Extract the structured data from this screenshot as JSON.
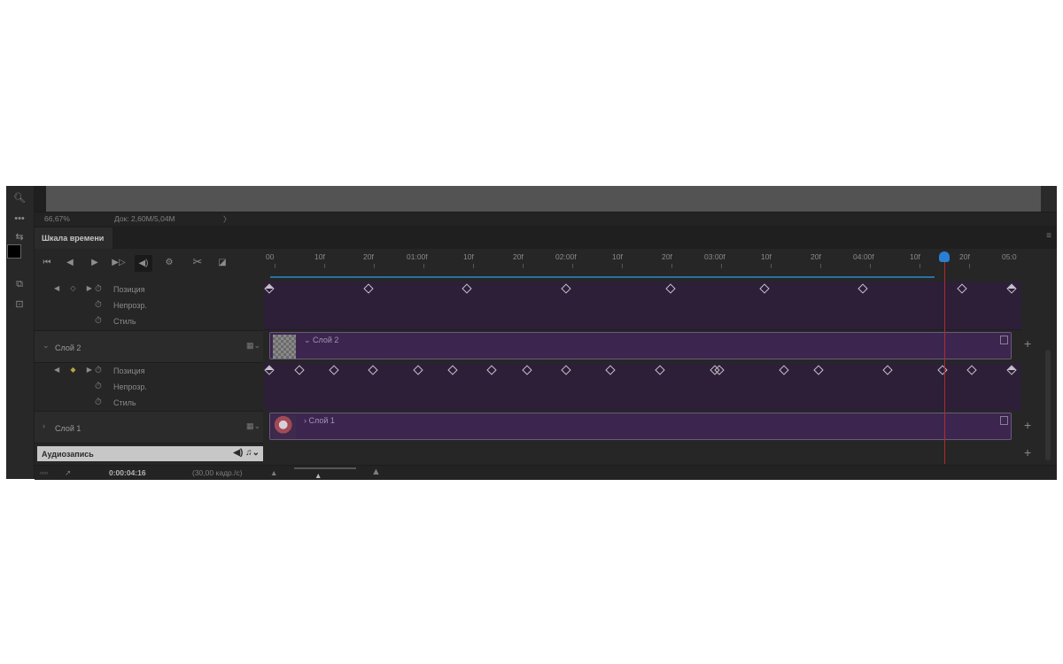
{
  "status_bar": {
    "zoom": "66,67%",
    "doc": "Док: 2,60M/5,04M",
    "arrow": "〉"
  },
  "panel": {
    "tab": "Шкала времени",
    "menu_icon": "≡"
  },
  "controls": [
    "⏮",
    "◀",
    "▶",
    "▶▷",
    "◀)",
    "⚙",
    "✂",
    "◪"
  ],
  "ruler": {
    "labels": [
      "00",
      "10f",
      "20f",
      "01:00f",
      "10f",
      "20f",
      "02:00f",
      "10f",
      "20f",
      "03:00f",
      "10f",
      "20f",
      "04:00f",
      "10f",
      "20f",
      "05:0"
    ]
  },
  "layers": {
    "props_top": [
      {
        "label": "Позиция"
      },
      {
        "label": "Непрозр."
      },
      {
        "label": "Стиль"
      }
    ],
    "layer2": {
      "label": "Слой 2",
      "clip": "Слой 2"
    },
    "props_mid": [
      {
        "label": "Позиция"
      },
      {
        "label": "Непрозр."
      },
      {
        "label": "Стиль"
      }
    ],
    "layer1": {
      "label": "Слой 1",
      "clip": "Слой 1"
    },
    "audio": {
      "label": "Аудиозапись"
    }
  },
  "bottom": {
    "time": "0:00:04:16",
    "fps": "(30,00 кадр./с)"
  },
  "keyframes": {
    "row1_frames": [
      0,
      20,
      40,
      60,
      81,
      100,
      120,
      140,
      150
    ],
    "row4_frames": [
      0,
      6,
      13,
      21,
      30,
      37,
      45,
      52,
      60,
      69,
      79,
      90,
      91,
      104,
      111,
      125,
      136,
      142,
      150
    ]
  },
  "colors": {
    "clip": "#3c2650",
    "playhead": "#b02a2a",
    "workarea": "#2b6fa3"
  }
}
